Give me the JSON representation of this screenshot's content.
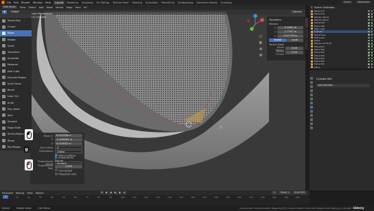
{
  "menu": {
    "items": [
      "File",
      "Edit",
      "Render",
      "Window",
      "Help"
    ],
    "workspaces": [
      "Layout",
      "Modeling",
      "Sculpting",
      "UV Editing",
      "Texture Paint",
      "Shading",
      "Animation",
      "Rendering",
      "Compositing",
      "Geometry Nodes",
      "Scripting"
    ],
    "active_workspace": "Layout",
    "scene": "Scene",
    "view_layer": "ViewLayer"
  },
  "viewport": {
    "mode": "Edit Mode",
    "menus": [
      "View",
      "Select",
      "Add",
      "Mesh",
      "Vertex",
      "Edge",
      "Face",
      "UV"
    ],
    "header2": [
      "Global",
      "Options"
    ],
    "overlay_line1": "User Perspective",
    "overlay_line2": "(1) Cylinder"
  },
  "tools": [
    {
      "label": "Select Box",
      "selected": false
    },
    {
      "label": "Cursor",
      "selected": false
    },
    {
      "label": "Move",
      "selected": true
    },
    {
      "label": "Rotate",
      "selected": false
    },
    {
      "label": "Scale",
      "selected": false
    },
    {
      "label": "Transform",
      "selected": false
    },
    {
      "label": "Annotate",
      "selected": false
    },
    {
      "label": "Measure",
      "selected": false
    },
    {
      "label": "Add Cube",
      "selected": false
    },
    {
      "label": "Extrude Region",
      "selected": false
    },
    {
      "label": "Inset Faces",
      "selected": false
    },
    {
      "label": "Bevel",
      "selected": false
    },
    {
      "label": "Loop Cut",
      "selected": false
    },
    {
      "label": "Knife",
      "selected": false
    },
    {
      "label": "Poly Build",
      "selected": false
    },
    {
      "label": "Spin",
      "selected": false
    },
    {
      "label": "Smooth",
      "selected": false
    },
    {
      "label": "Edge Slide",
      "selected": false
    },
    {
      "label": "Shrink/Fatten",
      "selected": false
    },
    {
      "label": "Shear",
      "selected": false
    },
    {
      "label": "Rip Region",
      "selected": false
    }
  ],
  "npanel": {
    "section": "Transform",
    "median_label": "Median:",
    "median": [
      {
        "axis": "X",
        "value": "-2.5452 m"
      },
      {
        "axis": "Y",
        "value": "-1.7797 m"
      },
      {
        "axis": "Z",
        "value": "0.91776 m"
      }
    ],
    "toggle_global": "Global",
    "toggle_local": "Local",
    "vertex_label": "Vertex Data:",
    "bevel_weight_label": "Bevel Weight",
    "bevel_weight": "0.00",
    "vertex_crease_label": "Vertex Crease",
    "vertex_crease": "0.00"
  },
  "operator": {
    "move_x_label": "Move X",
    "move_x": "0.012208 m",
    "y_label": "Y",
    "y": "-0.016945 m",
    "z_label": "Z",
    "z": "0.015852 m",
    "orientation_label": "Orientation",
    "axis_ortho_label": "Axis Ortho",
    "axis_ortho": "X",
    "orientation": "Global",
    "mirror_editing": "Mirror Editing",
    "proportional_editing": "Proportional Editing",
    "falloff_label": "Proportional Falloff",
    "falloff": "Smooth",
    "size_label": "Proportional Size",
    "size": "1.000",
    "connected": "Connected",
    "projected": "Projected (2D)"
  },
  "keys": {
    "g": "g"
  },
  "outliner": {
    "title": "Scene Collection",
    "items": [
      {
        "label": "Plane.011",
        "selected": false
      },
      {
        "label": "Plane.010",
        "selected": false
      },
      {
        "label": "Pavilion Wood",
        "selected": false
      },
      {
        "label": "Pavilion Panel",
        "selected": false
      },
      {
        "label": "Plane.009",
        "selected": false
      },
      {
        "label": "Plane.008",
        "selected": false
      },
      {
        "label": "Main Logo",
        "selected": false
      },
      {
        "label": "Cylinder",
        "selected": true
      },
      {
        "label": "Text Frame",
        "selected": false
      },
      {
        "label": "Fast Cube",
        "selected": false
      },
      {
        "label": "Rebar",
        "selected": false
      },
      {
        "label": "Pillows and Stuff",
        "selected": false
      },
      {
        "label": "Plane.007",
        "selected": false
      },
      {
        "label": "Plane.006",
        "selected": false
      },
      {
        "label": "Plane.005",
        "selected": false
      },
      {
        "label": "Plane.004",
        "selected": false
      },
      {
        "label": "Plane.003",
        "selected": false
      },
      {
        "label": "Plane.002",
        "selected": false
      },
      {
        "label": "Plane.001",
        "selected": false
      },
      {
        "label": "Plane",
        "selected": false
      }
    ]
  },
  "properties": {
    "object_name": "Cylinder.004",
    "add_modifier": "Add Modifier"
  },
  "timeline": {
    "menus": [
      "Playback",
      "Keying",
      "View",
      "Marker"
    ],
    "current_frame": "1",
    "start_label": "Start",
    "start": "1",
    "end_label": "End",
    "end": "250",
    "ticks": [
      "0",
      "10",
      "20",
      "30",
      "40",
      "50",
      "60",
      "70",
      "80",
      "90",
      "100",
      "110",
      "120",
      "130",
      "140",
      "150",
      "160",
      "170",
      "180",
      "190",
      "200",
      "210",
      "220",
      "230",
      "240",
      "250"
    ]
  },
  "statusbar": {
    "select": "Select",
    "rotate": "Rotate View",
    "call_menu": "Call Menu",
    "stats": "Cylinder.004 | Verts:12/1,960 | Edges:0/2,757 | Faces:0/3,099 | Tris:6,136 | Objects:1/59 | Memory: 1.04 GiB | 3.1.2"
  },
  "watermark": "Udemy"
}
